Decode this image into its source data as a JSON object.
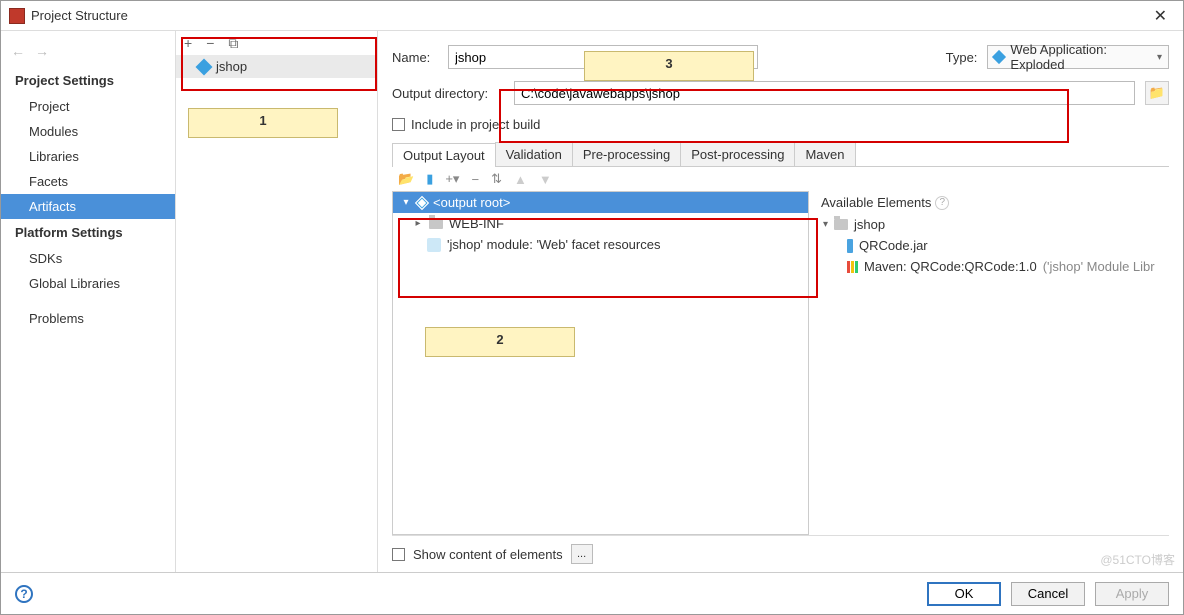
{
  "window": {
    "title": "Project Structure",
    "close": "✕"
  },
  "nav": {
    "back": "←",
    "forward": "→"
  },
  "sidebar": {
    "heading1": "Project Settings",
    "items1": [
      "Project",
      "Modules",
      "Libraries",
      "Facets",
      "Artifacts"
    ],
    "selected1": 4,
    "heading2": "Platform Settings",
    "items2": [
      "SDKs",
      "Global Libraries"
    ],
    "problems": "Problems"
  },
  "middle": {
    "toolbar": {
      "add": "+",
      "remove": "−",
      "copy": "⧉"
    },
    "items": [
      {
        "label": "jshop"
      }
    ]
  },
  "form": {
    "nameLabel": "Name:",
    "name": "jshop",
    "typeLabel": "Type:",
    "typeValue": "Web Application: Exploded",
    "outdirLabel": "Output directory:",
    "outdir": "C:\\code\\javawebapps\\jshop",
    "includeLabel": "Include in project build"
  },
  "tabs": [
    "Output Layout",
    "Validation",
    "Pre-processing",
    "Post-processing",
    "Maven"
  ],
  "activeTab": 0,
  "outputTree": {
    "root": "<output root>",
    "children": [
      {
        "label": "WEB-INF",
        "icon": "folder",
        "expandable": true
      },
      {
        "label": "'jshop' module: 'Web' facet resources",
        "icon": "web"
      }
    ]
  },
  "available": {
    "header": "Available Elements",
    "project": "jshop",
    "children": [
      {
        "label": "QRCode.jar",
        "icon": "jar"
      },
      {
        "label": "Maven: QRCode:QRCode:1.0",
        "suffix": "('jshop' Module Libr",
        "icon": "maven"
      }
    ]
  },
  "bottom": {
    "showContent": "Show content of elements",
    "ellipsis": "..."
  },
  "footer": {
    "ok": "OK",
    "cancel": "Cancel",
    "apply": "Apply"
  },
  "annotations": {
    "b1": "1",
    "b2": "2",
    "b3": "3"
  },
  "watermark": "@51CTO博客"
}
